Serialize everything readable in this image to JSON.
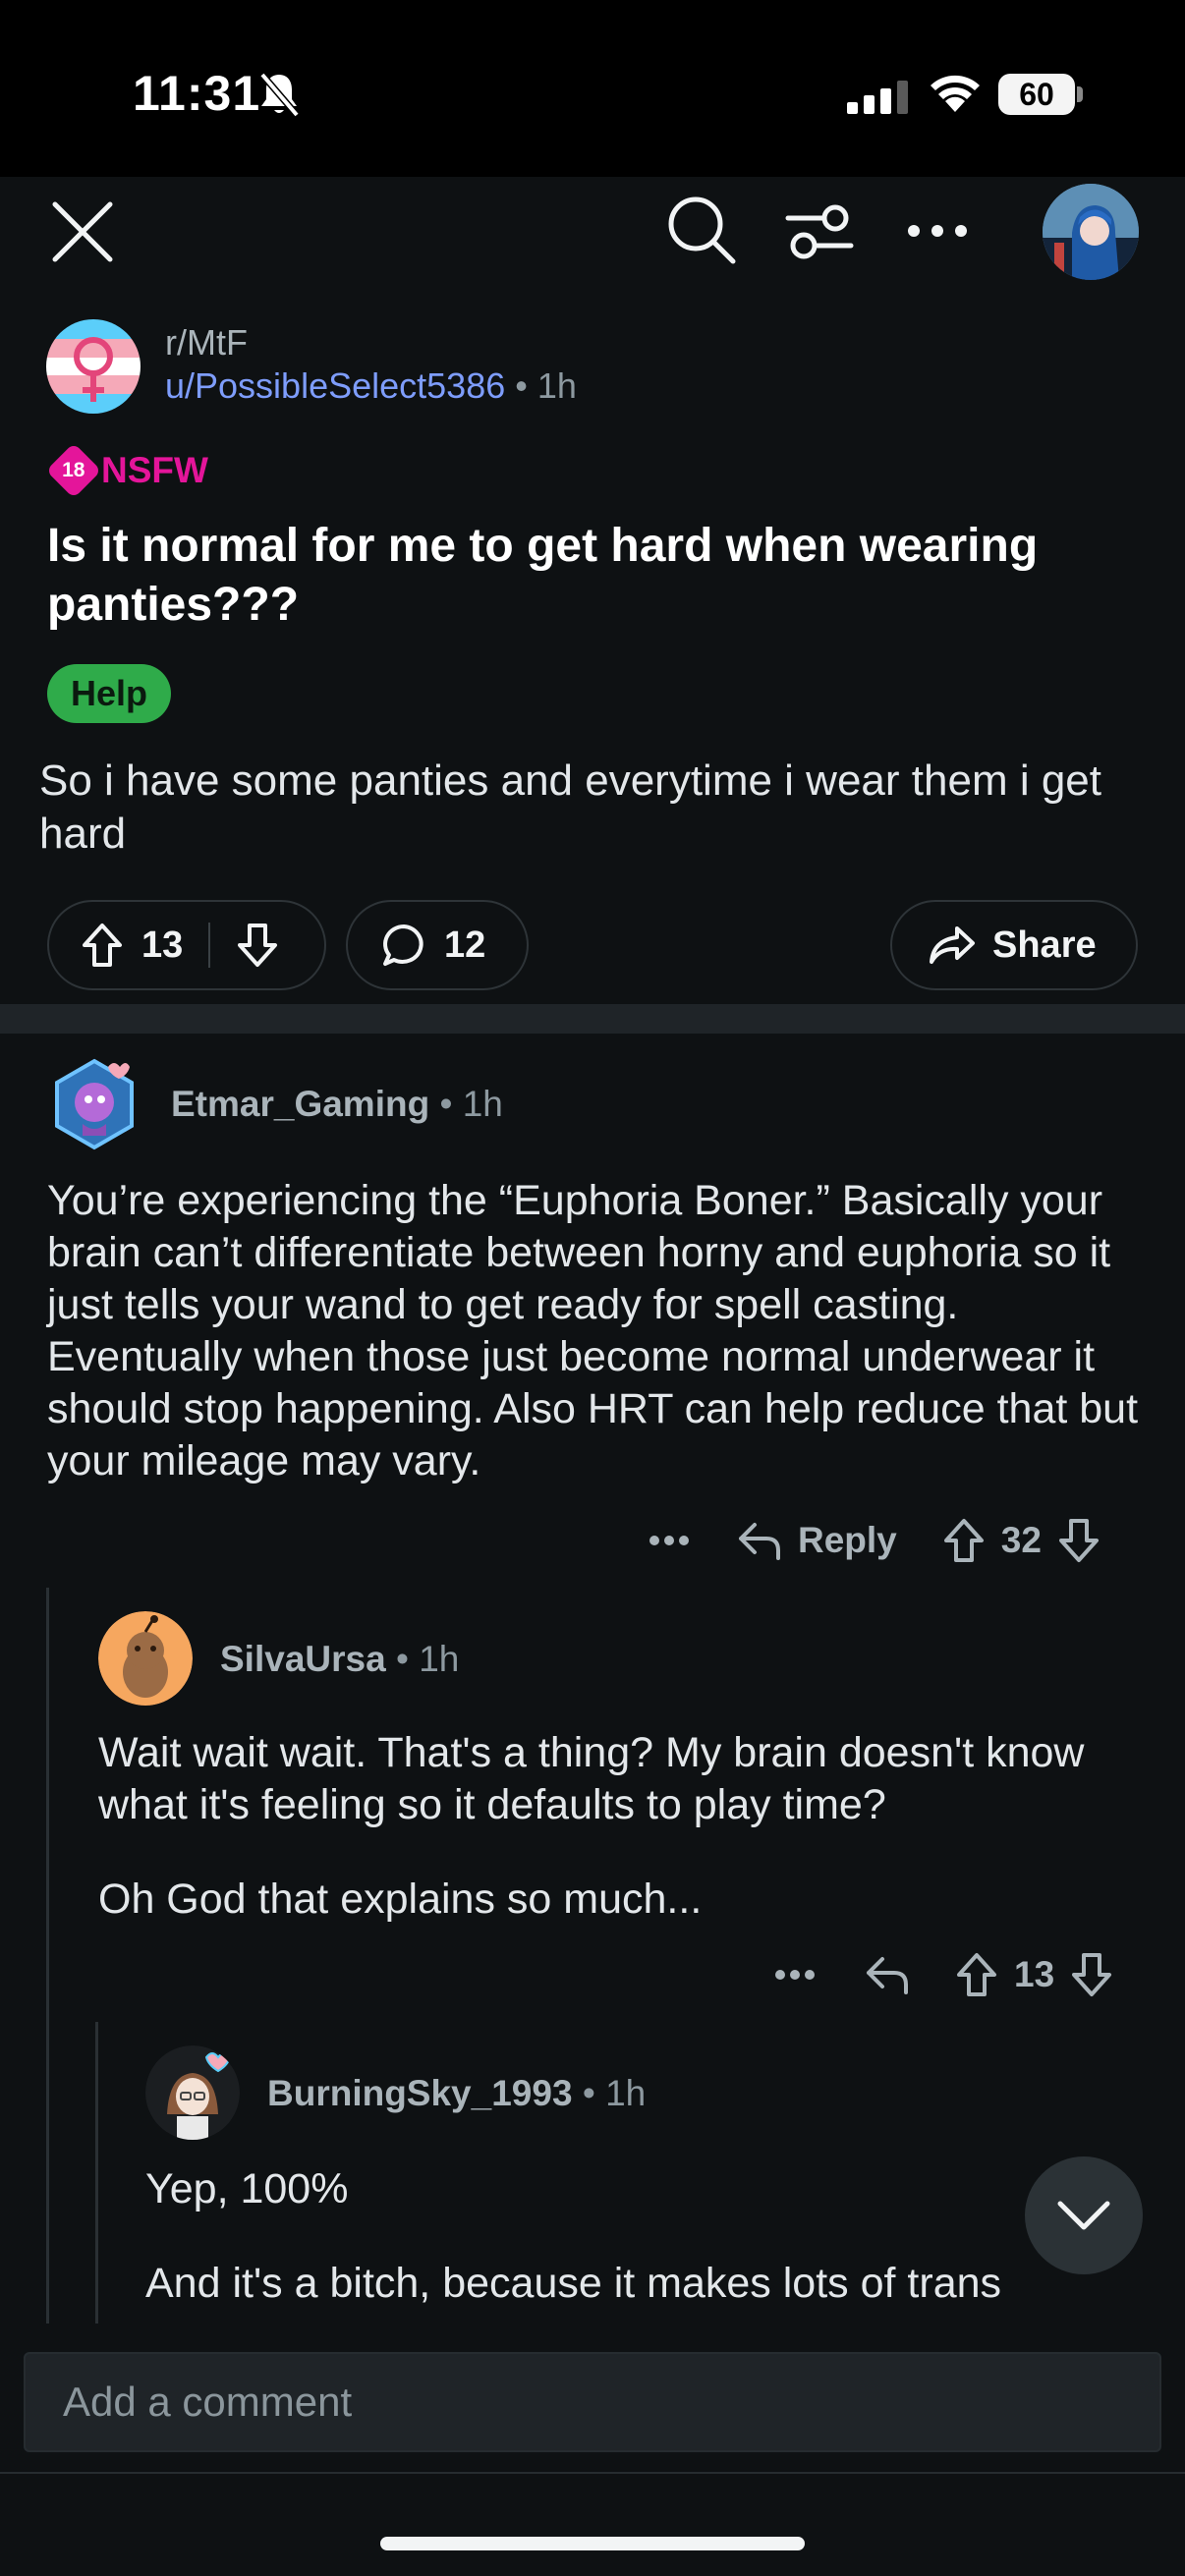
{
  "status_bar": {
    "time": "11:31",
    "battery": "60"
  },
  "toolbar": {
    "icons": [
      "close-icon",
      "search-icon",
      "filter-icon",
      "more-icon"
    ]
  },
  "post": {
    "subreddit": "r/MtF",
    "author": "u/PossibleSelect5386",
    "separator": "•",
    "age": "1h",
    "nsfw_badge": "18",
    "nsfw_label": "NSFW",
    "title": "Is it normal for me to get hard when wearing panties???",
    "flair": "Help",
    "body": "So i have some panties and everytime i wear them i get hard",
    "upvotes": "13",
    "comments": "12",
    "share_label": "Share"
  },
  "comments": [
    {
      "username": "Etmar_Gaming",
      "age": "1h",
      "text": "You’re experiencing the “Euphoria Boner.” Basically your brain can’t differentiate between horny and euphoria so it just tells your wand to get ready for spell casting. Eventually when those just become normal underwear it should stop happening. Also HRT can help reduce that but your mileage may vary.",
      "reply_label": "Reply",
      "votes": "32"
    },
    {
      "username": "SilvaUrsa",
      "age": "1h",
      "paragraphs": [
        "Wait wait wait. That's a thing? My brain doesn't know what it's feeling so it defaults to play time?",
        "Oh God that explains so much..."
      ],
      "votes": "13"
    },
    {
      "username": "BurningSky_1993",
      "age": "1h",
      "paragraphs": [
        "Yep, 100%",
        "And it's a bitch, because it makes lots of trans"
      ]
    }
  ],
  "composer": {
    "placeholder": "Add a comment"
  },
  "colors": {
    "background": "#0e1113",
    "link": "#7e9dfc",
    "nsfw": "#e4159a",
    "flair": "#2fab4a"
  }
}
